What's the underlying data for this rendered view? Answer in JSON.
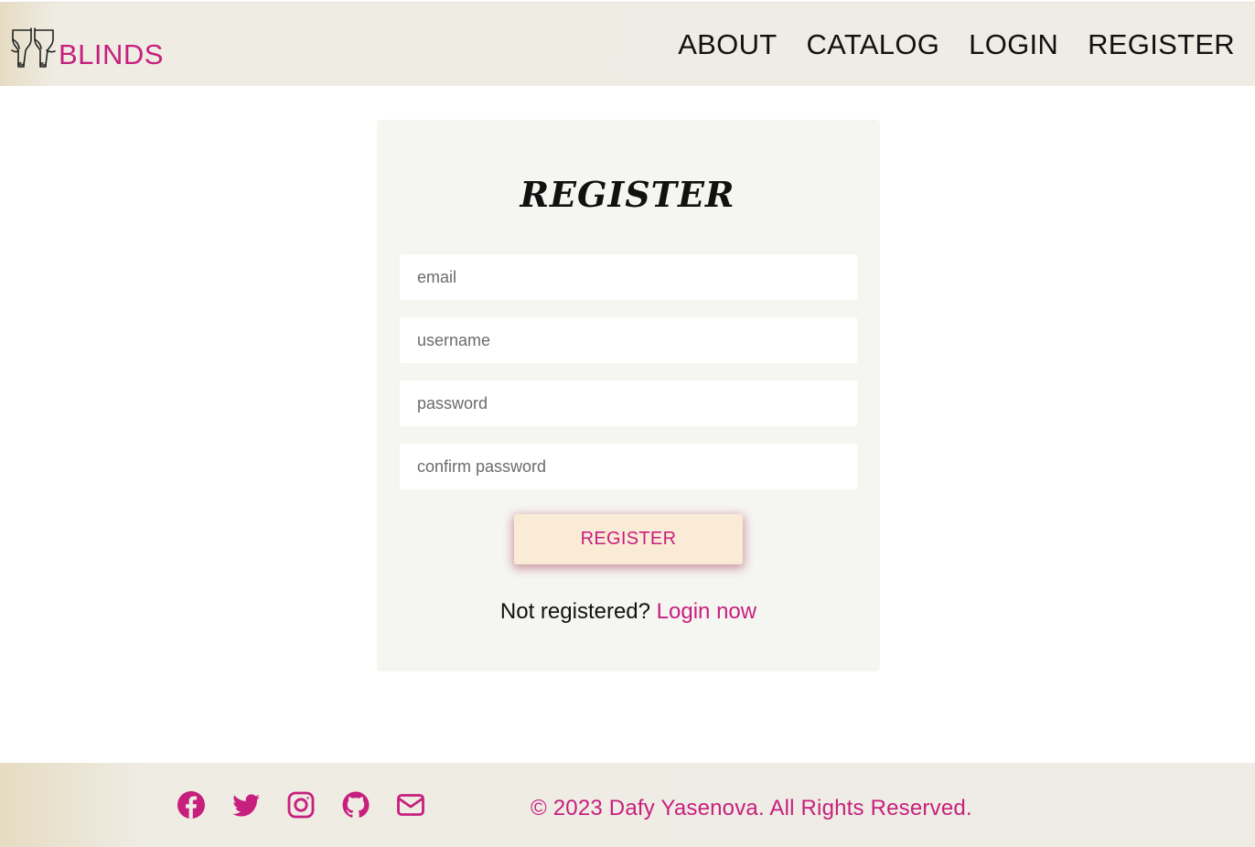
{
  "header": {
    "brand": "BLINDS",
    "nav": [
      "ABOUT",
      "CATALOG",
      "LOGIN",
      "REGISTER"
    ]
  },
  "form": {
    "title": "REGISTER",
    "fields": [
      {
        "placeholder": "email",
        "value": ""
      },
      {
        "placeholder": "username",
        "value": ""
      },
      {
        "placeholder": "password",
        "value": ""
      },
      {
        "placeholder": "confirm password",
        "value": ""
      }
    ],
    "submit_label": "REGISTER",
    "switch_text": "Not registered?",
    "switch_link": "Login now"
  },
  "footer": {
    "social_icons": [
      "facebook-icon",
      "twitter-icon",
      "instagram-icon",
      "github-icon",
      "mail-icon"
    ],
    "copyright": "© 2023 Dafy Yasenova. All Rights Reserved."
  },
  "colors": {
    "accent": "#c71f7e",
    "button_bg": "#faebd7",
    "card_bg": "#f5f5f1",
    "bar_bg": "#eeece4"
  }
}
